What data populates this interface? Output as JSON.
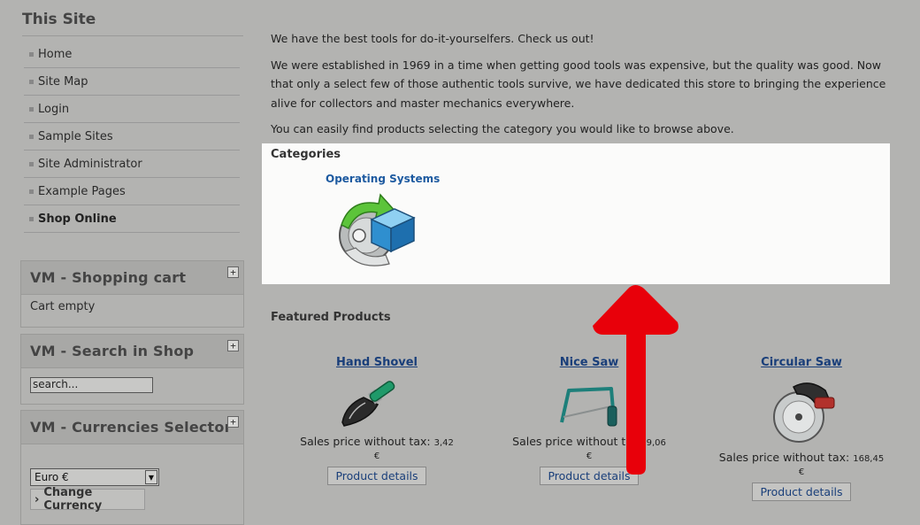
{
  "sidebar": {
    "site_title": "This Site",
    "menu": [
      {
        "label": "Home",
        "active": false
      },
      {
        "label": "Site Map",
        "active": false
      },
      {
        "label": "Login",
        "active": false
      },
      {
        "label": "Sample Sites",
        "active": false
      },
      {
        "label": "Site Administrator",
        "active": false
      },
      {
        "label": "Example Pages",
        "active": false
      },
      {
        "label": "Shop Online",
        "active": true
      }
    ],
    "cart": {
      "title": "VM - Shopping cart",
      "toggle": "+",
      "status": "Cart empty"
    },
    "search": {
      "title": "VM - Search in Shop",
      "toggle": "+",
      "value": "search..."
    },
    "currency": {
      "title": "VM - Currencies Selector",
      "toggle": "+",
      "selected": "Euro €",
      "button": "Change Currency",
      "button_prefix": "›"
    }
  },
  "main": {
    "intro": "We have the best tools for do-it-yourselfers. Check us out!",
    "history": "We were established in 1969 in a time when getting good tools was expensive, but the quality was good. Now that only a select few of those authentic tools survive, we have dedicated this store to bringing the experience alive for collectors and master mechanics everywhere.",
    "hint": "You can easily find products selecting the category you would like to browse above.",
    "categories": {
      "title": "Categories",
      "items": [
        {
          "label": "Operating Systems",
          "icon": "os-install-icon"
        }
      ]
    },
    "featured": {
      "title": "Featured Products",
      "products": [
        {
          "name": "Hand Shovel",
          "price_label": "Sales price without tax:",
          "price": "3,42 €",
          "button": "Product details",
          "icon": "hand-shovel-icon"
        },
        {
          "name": "Nice Saw",
          "price_label": "Sales price without tax:",
          "price": "9,06 €",
          "button": "Product details",
          "icon": "hacksaw-icon"
        },
        {
          "name": "Circular Saw",
          "price_label": "Sales price without tax:",
          "price": "168,45 €",
          "button": "Product details",
          "icon": "circular-saw-icon"
        }
      ]
    }
  },
  "overlay": {
    "annotation": "red-arrow-pointing-up",
    "color": "#e8000a"
  },
  "colors": {
    "page_bg": "#b3b3b1",
    "categories_bg": "#fbfbfa",
    "link": "#1d5aa0"
  }
}
